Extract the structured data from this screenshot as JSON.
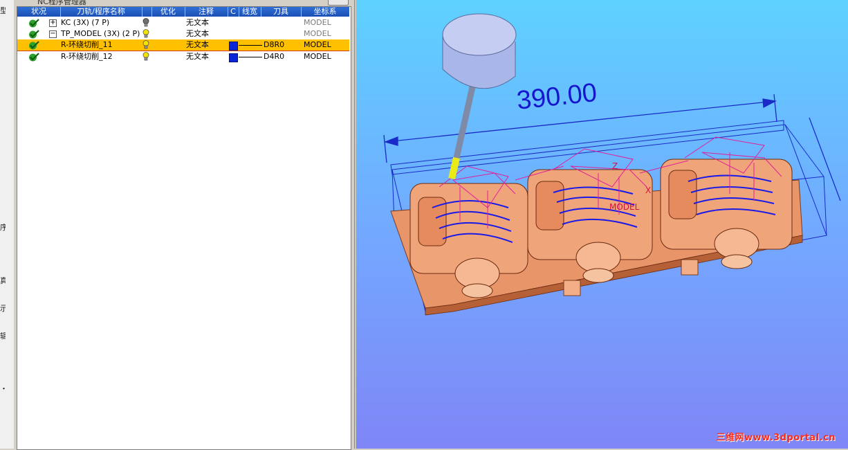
{
  "left_strip": {
    "chars": [
      "型",
      "序",
      "真",
      "示",
      "辑",
      "・"
    ]
  },
  "panel": {
    "title": "NC程序管理器"
  },
  "table": {
    "headers": [
      "状况",
      "刀轨/程序名称",
      "",
      "优化",
      "注释",
      "C",
      "线宽",
      "刀具",
      "坐标系"
    ],
    "rows": [
      {
        "name": "KC (3X) (7 P)",
        "expander": "+",
        "comment": "无文本",
        "tool": "",
        "cs": "MODEL",
        "bulb": "dark"
      },
      {
        "name": "TP_MODEL (3X) (2 P)",
        "expander": "−",
        "comment": "无文本",
        "tool": "",
        "cs": "MODEL",
        "bulb": "yellow"
      },
      {
        "name": "R-环绕切削_11",
        "expander": "",
        "comment": "无文本",
        "tool": "D8R0",
        "cs": "MODEL",
        "bulb": "yellow"
      },
      {
        "name": "R-环绕切削_12",
        "expander": "",
        "comment": "无文本",
        "tool": "D4R0",
        "cs": "MODEL",
        "bulb": "yellow"
      }
    ]
  },
  "viewport": {
    "dimension": "390.00",
    "axis_z": "Z",
    "axis_x": "X",
    "axis_model": "MODEL",
    "watermark": "三维网www.3dportal.cn"
  },
  "colors": {
    "header_blue": "#1b4fb4",
    "selection": "#ffc000",
    "tool_color": "#0b24d6",
    "part_fill": "#f0a47a",
    "toolpath_magenta": "#e0209a",
    "toolpath_blue": "#1a1ae8"
  },
  "icons": [
    "check-icon",
    "expand-icon",
    "collapse-icon",
    "lightbulb-icon"
  ]
}
